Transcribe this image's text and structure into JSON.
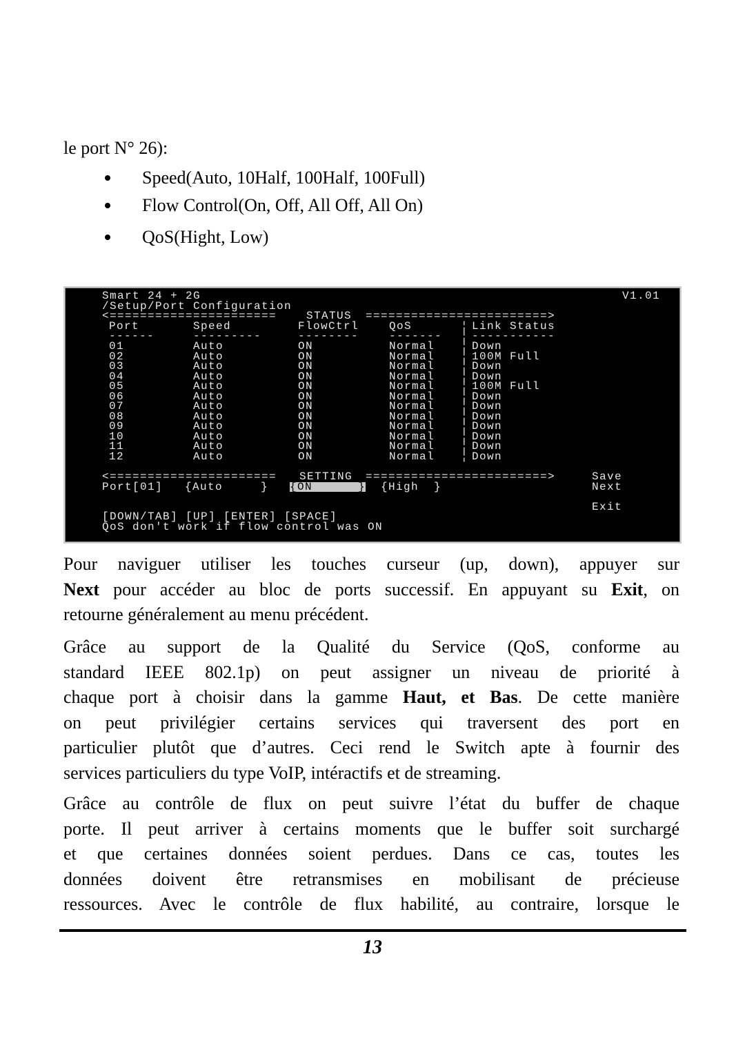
{
  "intro": "le port N° 26):",
  "bullets": [
    "Speed(Auto, 10Half, 100Half, 100Full)",
    "Flow Control(On, Off, All Off, All On)",
    "QoS(Hight, Low)"
  ],
  "terminal": {
    "title": "Smart 24 + 2G",
    "version": "V1.01",
    "path": "/Setup/Port Configuration",
    "status_left": "<======================",
    "status_label": "STATUS",
    "status_right": "========================>",
    "headers": [
      "Port",
      "Speed",
      "FlowCtrl",
      "QoS",
      "Link Status"
    ],
    "header_dashes": [
      "------",
      "---------",
      "--------",
      "-------",
      "-----------"
    ],
    "rows": [
      [
        "01",
        "Auto",
        "ON",
        "Normal",
        "Down"
      ],
      [
        "02",
        "Auto",
        "ON",
        "Normal",
        "100M Full"
      ],
      [
        "03",
        "Auto",
        "ON",
        "Normal",
        "Down"
      ],
      [
        "04",
        "Auto",
        "ON",
        "Normal",
        "Down"
      ],
      [
        "05",
        "Auto",
        "ON",
        "Normal",
        "100M Full"
      ],
      [
        "06",
        "Auto",
        "ON",
        "Normal",
        "Down"
      ],
      [
        "07",
        "Auto",
        "ON",
        "Normal",
        "Down"
      ],
      [
        "08",
        "Auto",
        "ON",
        "Normal",
        "Down"
      ],
      [
        "09",
        "Auto",
        "ON",
        "Normal",
        "Down"
      ],
      [
        "10",
        "Auto",
        "ON",
        "Normal",
        "Down"
      ],
      [
        "11",
        "Auto",
        "ON",
        "Normal",
        "Down"
      ],
      [
        "12",
        "Auto",
        "ON",
        "Normal",
        "Down"
      ]
    ],
    "setting_left": "<======================",
    "setting_label": "SETTING",
    "setting_right": "========================>",
    "setting_port": "Port[01]",
    "setting_speed": "{Auto     }",
    "setting_flow": "{ON      }",
    "setting_qos": "{High  }",
    "save": "Save",
    "next": "Next",
    "exit": "Exit",
    "keys": "[DOWN/TAB] [UP] [ENTER] [SPACE]",
    "note": "QoS don't work if flow control was ON"
  },
  "paragraphs": [
    [
      "Pour naviguer utiliser les touches curseur (up, down), appuyer sur",
      "|Next| pour accéder au bloc de ports successif. En appuyant su |Exit|, on",
      "retourne généralement au menu précédent."
    ],
    [
      "Grâce au support de la Qualité du Service (QoS, conforme au",
      "standard IEEE 802.1p) on peut assigner un niveau de priorité à",
      "chaque port à choisir dans la gamme |Haut, et Bas|. De cette manière",
      "on peut privilégier certains services qui traversent des port  en",
      "particulier plutôt que d’autres. Ceci rend le Switch apte à fournir des",
      "services particuliers du type VoIP, intéractifs et de streaming."
    ],
    [
      "Grâce au contrôle de flux on peut suivre l’état du buffer de chaque",
      "porte. Il peut arriver à certains moments que le buffer soit surchargé",
      "et que certaines données soient perdues. Dans ce cas, toutes les",
      "données doivent être retransmises en mobilisant de précieuse",
      "ressources. Avec le contrôle de flux habilité, au contraire, lorsque le"
    ]
  ],
  "page_number": "13"
}
